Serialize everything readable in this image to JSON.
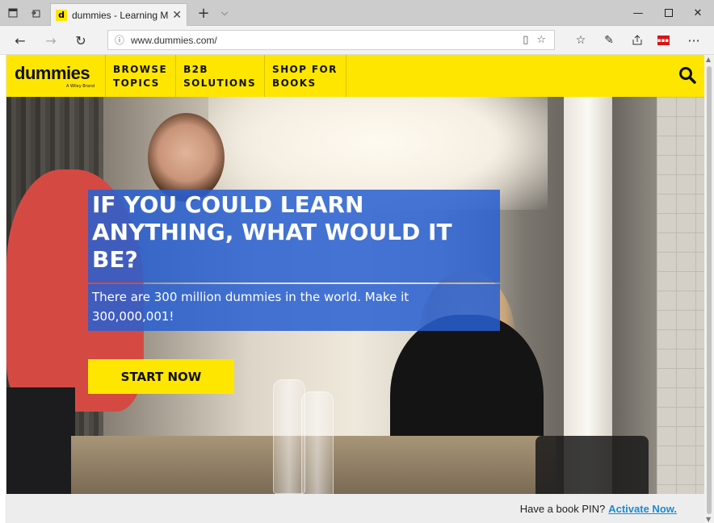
{
  "browser": {
    "tab_title": "dummies - Learning Ma",
    "favicon_letter": "d",
    "url": "www.dummies.com/",
    "icons": [
      "tab-preview-icon",
      "set-aside-tabs-icon",
      "close-icon",
      "new-tab-icon",
      "chevron-down-icon",
      "minimize-icon",
      "maximize-icon",
      "close-window-icon",
      "back-icon",
      "forward-icon",
      "refresh-icon",
      "info-icon",
      "reading-view-icon",
      "star-icon",
      "favorites-icon",
      "pen-icon",
      "share-icon",
      "pdf-extension-icon",
      "more-icon"
    ]
  },
  "site": {
    "logo": "dummies",
    "logo_tagline": "A Wiley Brand",
    "nav": [
      {
        "line1": "BROWSE",
        "line2": "TOPICS"
      },
      {
        "line1": "B2B",
        "line2": "SOLUTIONS"
      },
      {
        "line1": "SHOP FOR",
        "line2": "BOOKS"
      }
    ],
    "accent_color": "#ffe600"
  },
  "hero": {
    "headline": "IF YOU COULD LEARN ANYTHING, WHAT WOULD IT BE?",
    "subline": "There are 300 million dummies in the world. Make it 300,000,001!",
    "cta_label": "START NOW",
    "overlay_color": "#2860d2"
  },
  "pin_bar": {
    "prompt": "Have a book PIN?",
    "link": "Activate Now."
  }
}
